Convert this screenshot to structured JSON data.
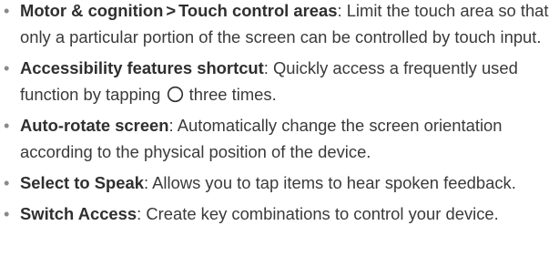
{
  "items": [
    {
      "term_a": "Motor & cognition",
      "separator": ">",
      "term_b": "Touch control areas",
      "desc": ": Limit the touch area so that only a particular portion of the screen can be controlled by touch input."
    },
    {
      "term": "Accessibility features shortcut",
      "desc_before_icon": ": Quickly access a frequently used function by tapping ",
      "icon": "home-button-circle-icon",
      "desc_after_icon": " three times."
    },
    {
      "term": "Auto-rotate screen",
      "desc": ": Automatically change the screen orientation according to the physical position of the device."
    },
    {
      "term": "Select to Speak",
      "desc": ": Allows you to tap items to hear spoken feedback."
    },
    {
      "term": "Switch Access",
      "desc": ": Create key combinations to control your device."
    }
  ],
  "bullet_char": "•"
}
